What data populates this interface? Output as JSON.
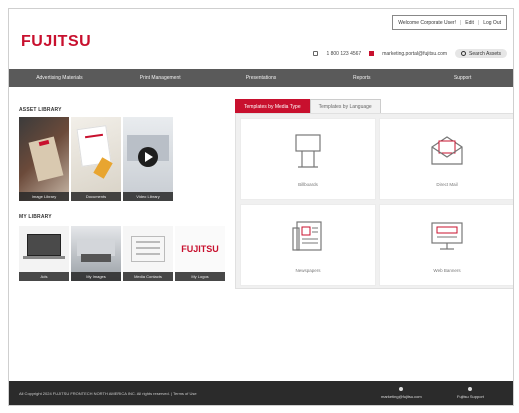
{
  "header": {
    "logo": "FUJITSU",
    "welcome": "Welcome Corporate User!",
    "links": [
      "Edit",
      "Log Out"
    ],
    "phone": "1 800 123 4567",
    "email": "marketing.portal@fujitsu.com",
    "search_label": "Search Assets"
  },
  "nav": {
    "items": [
      "Advertising Materials",
      "Print Management",
      "Presentations",
      "Reports",
      "Support"
    ]
  },
  "asset_library": {
    "title": "ASSET LIBRARY",
    "tiles": [
      "Image Library",
      "Documents",
      "Video Library"
    ]
  },
  "my_library": {
    "title": "MY LIBRARY",
    "tiles": [
      "Ads",
      "My Images",
      "Media Contacts",
      "My Logos"
    ]
  },
  "tabs": [
    "Templates by Media Type",
    "Templates by Language"
  ],
  "media_types": [
    "Billboards",
    "Direct Mail",
    "Newspapers",
    "Web Banners"
  ],
  "footer": {
    "copyright": "All Copyright 2024 FUJITSU FRONTECH NORTH AMERICA INC. All rights reserved.   |   Terms of Use",
    "contacts": [
      "marketing@fujitsu.com",
      "Fujitsu Support"
    ]
  },
  "colors": {
    "brand": "#c8102e",
    "nav_bg": "#5a5a5a",
    "footer_bg": "#2b2b2b"
  }
}
